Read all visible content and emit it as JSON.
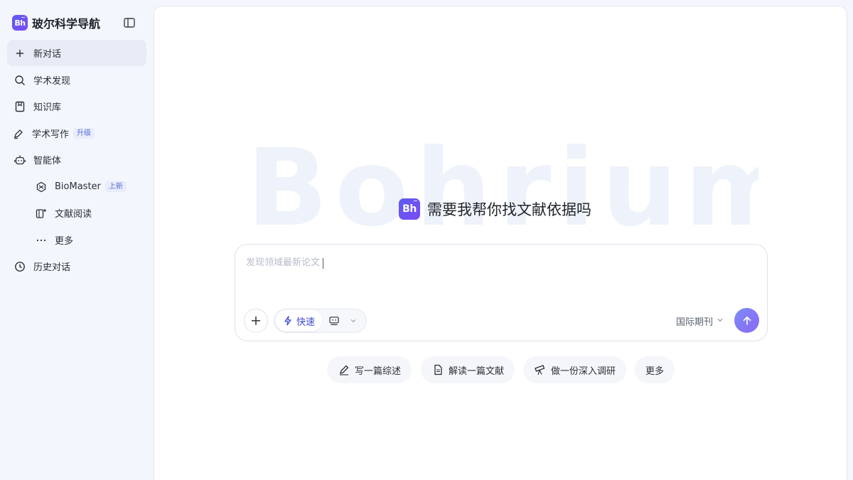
{
  "brand": {
    "name": "玻尔科学导航",
    "logo_text": "Bh"
  },
  "sidebar": {
    "items": [
      {
        "label": "新对话",
        "icon": "plus-icon",
        "active": true
      },
      {
        "label": "学术发现",
        "icon": "search-icon"
      },
      {
        "label": "知识库",
        "icon": "book-icon"
      },
      {
        "label": "学术写作",
        "icon": "pen-icon",
        "badge": "升级"
      },
      {
        "label": "智能体",
        "icon": "robot-icon"
      },
      {
        "label": "BioMaster",
        "icon": "biomaster-icon",
        "badge": "上新"
      },
      {
        "label": "文献阅读",
        "icon": "reader-icon"
      },
      {
        "label": "更多",
        "icon": "more-dots-icon"
      },
      {
        "label": "历史对话",
        "icon": "clock-icon"
      }
    ]
  },
  "main": {
    "watermark": "Bohrium",
    "hero_logo_text": "Bh",
    "hero_title": "需要我帮你找文献依据吗",
    "input": {
      "placeholder": "发现领域最新论文",
      "value": ""
    },
    "mode": {
      "label": "快速",
      "icon": "lightning-icon"
    },
    "journal_filter": "国际期刊",
    "suggestions": [
      {
        "label": "写一篇综述",
        "icon": "pencil-icon"
      },
      {
        "label": "解读一篇文献",
        "icon": "document-icon"
      },
      {
        "label": "做一份深入调研",
        "icon": "telescope-icon"
      },
      {
        "label": "更多"
      }
    ]
  },
  "colors": {
    "accent": "#3c4ad0",
    "send_gradient_start": "#7c8cf7",
    "send_gradient_end": "#8b68f2",
    "logo": "#5b5cf0"
  }
}
